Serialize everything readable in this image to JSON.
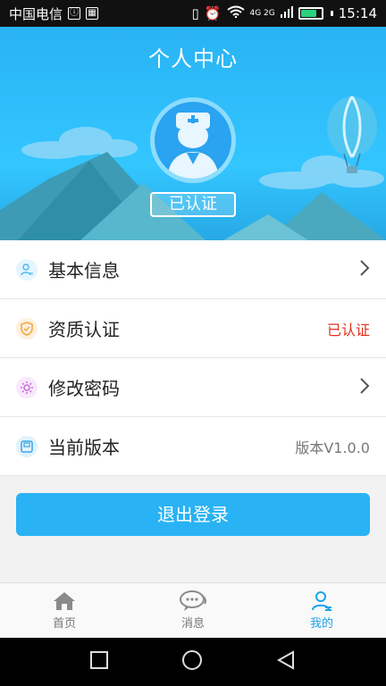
{
  "status_bar": {
    "carrier": "中国电信",
    "network": "4G 2G",
    "time": "15:14",
    "battery_level": 0.8
  },
  "header": {
    "title": "个人中心",
    "cert_badge": "已认证"
  },
  "menu": {
    "items": [
      {
        "label": "基本信息",
        "icon": "user-info-icon",
        "icon_color": "#4fb8ee"
      },
      {
        "label": "资质认证",
        "icon": "shield-icon",
        "icon_color": "#f1a43c",
        "status": "已认证"
      },
      {
        "label": "修改密码",
        "icon": "gear-icon",
        "icon_color": "#c66ad8"
      },
      {
        "label": "当前版本",
        "icon": "version-icon",
        "icon_color": "#3aa6e7",
        "value": "版本V1.0.0"
      }
    ]
  },
  "logout": {
    "label": "退出登录"
  },
  "tabs": [
    {
      "label": "首页",
      "icon": "home-icon",
      "active": false
    },
    {
      "label": "消息",
      "icon": "message-icon",
      "active": false
    },
    {
      "label": "我的",
      "icon": "profile-icon",
      "active": true
    }
  ],
  "colors": {
    "primary": "#29b2f4",
    "status_red": "#e0301e"
  }
}
